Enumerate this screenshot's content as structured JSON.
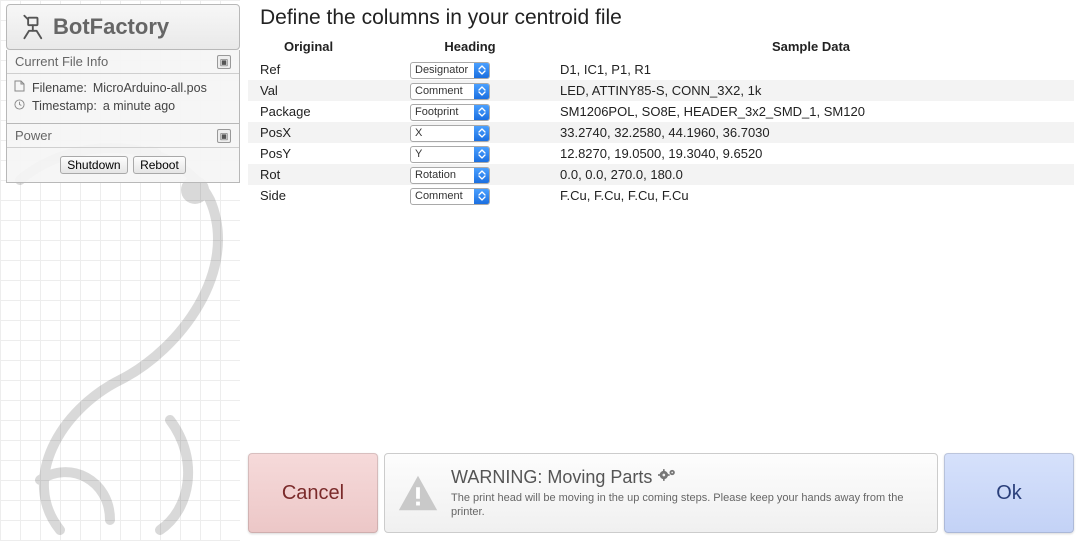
{
  "brand": {
    "title": "BotFactory"
  },
  "sidebar": {
    "file_panel": {
      "title": "Current File Info",
      "filename_label": "Filename:",
      "filename_value": "MicroArduino-all.pos",
      "timestamp_label": "Timestamp:",
      "timestamp_value": "a minute ago"
    },
    "power_panel": {
      "title": "Power",
      "shutdown": "Shutdown",
      "reboot": "Reboot"
    }
  },
  "main": {
    "title": "Define the columns in your centroid file",
    "headers": {
      "original": "Original",
      "heading": "Heading",
      "sample": "Sample Data"
    },
    "rows": [
      {
        "original": "Ref",
        "heading": "Designator",
        "sample": "D1, IC1, P1, R1"
      },
      {
        "original": "Val",
        "heading": "Comment",
        "sample": "LED, ATTINY85-S, CONN_3X2, 1k"
      },
      {
        "original": "Package",
        "heading": "Footprint",
        "sample": "SM1206POL, SO8E, HEADER_3x2_SMD_1, SM120"
      },
      {
        "original": "PosX",
        "heading": "X",
        "sample": "33.2740, 32.2580, 44.1960, 36.7030"
      },
      {
        "original": "PosY",
        "heading": "Y",
        "sample": "12.8270, 19.0500, 19.3040, 9.6520"
      },
      {
        "original": "Rot",
        "heading": "Rotation",
        "sample": "0.0, 0.0, 270.0, 180.0"
      },
      {
        "original": "Side",
        "heading": "Comment",
        "sample": "F.Cu, F.Cu, F.Cu, F.Cu"
      }
    ]
  },
  "footer": {
    "cancel": "Cancel",
    "ok": "Ok",
    "warning_title": "WARNING: Moving Parts",
    "warning_body": "The print head will be moving in the up coming steps. Please keep your hands away from the printer."
  }
}
